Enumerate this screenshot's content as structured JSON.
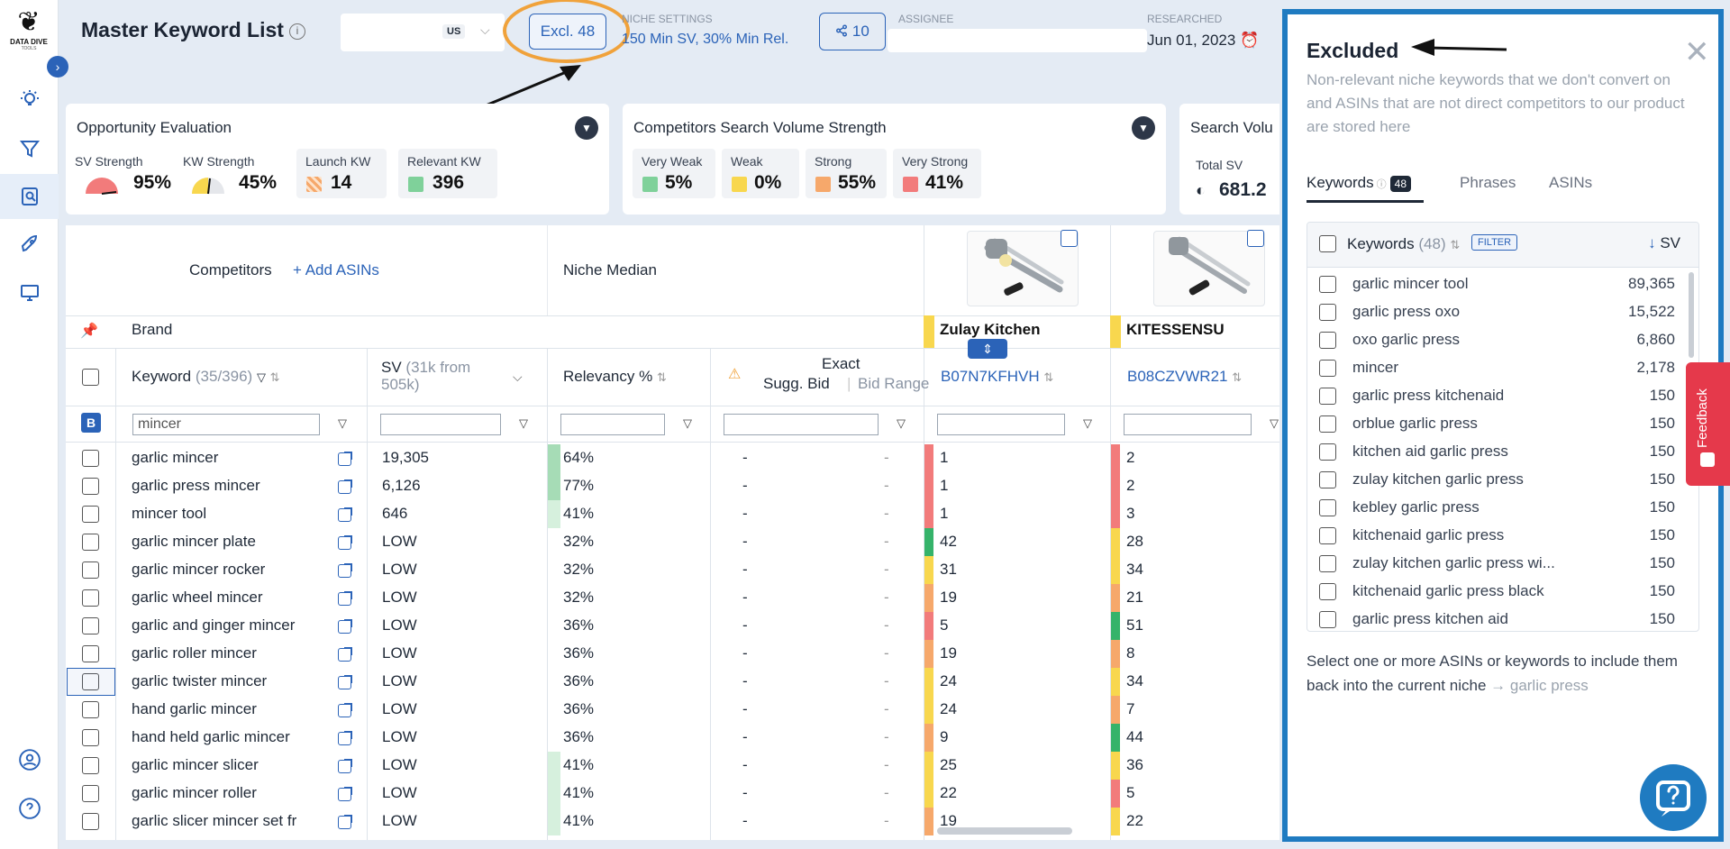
{
  "brand": {
    "name": "DATA DIVE",
    "sub": "TOOLS"
  },
  "header": {
    "title": "Master Keyword List",
    "market": "US",
    "excluded_button": "Excl. 48",
    "niche_settings_label": "NICHE SETTINGS",
    "niche_settings_value": "150 Min SV, 30% Min Rel.",
    "share_count": "10",
    "assignee_label": "ASSIGNEE",
    "researched_label": "RESEARCHED",
    "researched_date": "Jun 01, 2023"
  },
  "cards": {
    "opportunity": {
      "title": "Opportunity Evaluation",
      "sv_strength_label": "SV Strength",
      "sv_strength_value": "95%",
      "kw_strength_label": "KW Strength",
      "kw_strength_value": "45%",
      "launch_kw_label": "Launch KW",
      "launch_kw_value": "14",
      "relevant_kw_label": "Relevant KW",
      "relevant_kw_value": "396"
    },
    "competitors": {
      "title": "Competitors Search Volume Strength",
      "very_weak_label": "Very Weak",
      "very_weak_value": "5%",
      "weak_label": "Weak",
      "weak_value": "0%",
      "strong_label": "Strong",
      "strong_value": "55%",
      "very_strong_label": "Very Strong",
      "very_strong_value": "41%"
    },
    "search_volume": {
      "title": "Search Volu",
      "total_sv_label": "Total SV",
      "total_sv_value": "681.2"
    }
  },
  "colors": {
    "very_weak": "#7fd19a",
    "weak": "#f8d74e",
    "strong": "#f6a86b",
    "very_strong": "#f27b7b",
    "accent": "#2b63b8"
  },
  "table": {
    "competitors_label": "Competitors",
    "add_asins": "+ Add ASINs",
    "niche_median": "Niche Median",
    "brand_label": "Brand",
    "brand1": "Zulay Kitchen",
    "brand2": "KITESSENSU",
    "col_keyword": "Keyword",
    "col_keyword_count": "(35/396)",
    "col_sv": "SV",
    "col_sv_sub": "(31k from 505k)",
    "col_relevancy": "Relevancy %",
    "col_exact": "Exact",
    "col_sugg_bid": "Sugg. Bid",
    "col_bid_range": "Bid Range",
    "asin1": "B07N7KFHVH",
    "asin2": "B08CZVWR21",
    "filter_keyword_value": "mincer",
    "b_badge": "B",
    "rows": [
      {
        "kw": "garlic mincer",
        "sv": "19,305",
        "rel": "64%",
        "rel_color": "#a6dcb6",
        "r1": "1",
        "c1": "#f27b7b",
        "r2": "2",
        "c2": "#f27b7b"
      },
      {
        "kw": "garlic press mincer",
        "sv": "6,126",
        "rel": "77%",
        "rel_color": "#a6dcb6",
        "r1": "1",
        "c1": "#f27b7b",
        "r2": "2",
        "c2": "#f27b7b"
      },
      {
        "kw": "mincer tool",
        "sv": "646",
        "rel": "41%",
        "rel_color": "#d6f0dd",
        "r1": "1",
        "c1": "#f27b7b",
        "r2": "3",
        "c2": "#f27b7b"
      },
      {
        "kw": "garlic mincer plate",
        "sv": "LOW",
        "rel": "32%",
        "rel_color": "",
        "r1": "42",
        "c1": "#35b36a",
        "r2": "28",
        "c2": "#f8d74e"
      },
      {
        "kw": "garlic mincer rocker",
        "sv": "LOW",
        "rel": "32%",
        "rel_color": "",
        "r1": "31",
        "c1": "#f8d74e",
        "r2": "34",
        "c2": "#f8d74e"
      },
      {
        "kw": "garlic wheel mincer",
        "sv": "LOW",
        "rel": "32%",
        "rel_color": "",
        "r1": "19",
        "c1": "#f6a86b",
        "r2": "21",
        "c2": "#f6a86b"
      },
      {
        "kw": "garlic and ginger mincer",
        "sv": "LOW",
        "rel": "36%",
        "rel_color": "",
        "r1": "5",
        "c1": "#f27b7b",
        "r2": "51",
        "c2": "#35b36a"
      },
      {
        "kw": "garlic roller mincer",
        "sv": "LOW",
        "rel": "36%",
        "rel_color": "",
        "r1": "19",
        "c1": "#f6a86b",
        "r2": "8",
        "c2": "#f6a86b"
      },
      {
        "kw": "garlic twister mincer",
        "sv": "LOW",
        "rel": "36%",
        "rel_color": "",
        "r1": "24",
        "c1": "#f8d74e",
        "r2": "34",
        "c2": "#f8d74e"
      },
      {
        "kw": "hand garlic mincer",
        "sv": "LOW",
        "rel": "36%",
        "rel_color": "",
        "r1": "24",
        "c1": "#f8d74e",
        "r2": "7",
        "c2": "#f6a86b"
      },
      {
        "kw": "hand held garlic mincer",
        "sv": "LOW",
        "rel": "36%",
        "rel_color": "",
        "r1": "9",
        "c1": "#f6a86b",
        "r2": "44",
        "c2": "#35b36a"
      },
      {
        "kw": "garlic mincer slicer",
        "sv": "LOW",
        "rel": "41%",
        "rel_color": "#d6f0dd",
        "r1": "25",
        "c1": "#f8d74e",
        "r2": "36",
        "c2": "#f8d74e"
      },
      {
        "kw": "garlic mincer roller",
        "sv": "LOW",
        "rel": "41%",
        "rel_color": "#d6f0dd",
        "r1": "22",
        "c1": "#f8d74e",
        "r2": "5",
        "c2": "#f27b7b"
      },
      {
        "kw": "garlic slicer mincer set fr",
        "sv": "LOW",
        "rel": "41%",
        "rel_color": "#d6f0dd",
        "r1": "19",
        "c1": "#f6a86b",
        "r2": "22",
        "c2": "#f8d74e"
      }
    ],
    "dash": "-"
  },
  "panel": {
    "title": "Excluded",
    "description": "Non-relevant niche keywords that we don't convert on and ASINs that are not direct competitors to our product are stored here",
    "tab_keywords": "Keywords",
    "tab_keywords_count": "48",
    "tab_phrases": "Phrases",
    "tab_asins": "ASINs",
    "list_header": "Keywords",
    "list_count": "(48)",
    "filter_tag": "FILTER",
    "sort_col": "SV",
    "keywords": [
      {
        "k": "garlic mincer tool",
        "v": "89,365"
      },
      {
        "k": "garlic press oxo",
        "v": "15,522"
      },
      {
        "k": "oxo garlic press",
        "v": "6,860"
      },
      {
        "k": "mincer",
        "v": "2,178"
      },
      {
        "k": "garlic press kitchenaid",
        "v": "150"
      },
      {
        "k": "orblue garlic press",
        "v": "150"
      },
      {
        "k": "kitchen aid garlic press",
        "v": "150"
      },
      {
        "k": "zulay kitchen garlic press",
        "v": "150"
      },
      {
        "k": "kebley garlic press",
        "v": "150"
      },
      {
        "k": "kitchenaid garlic press",
        "v": "150"
      },
      {
        "k": "zulay kitchen garlic press wi...",
        "v": "150"
      },
      {
        "k": "kitchenaid garlic press black",
        "v": "150"
      },
      {
        "k": "garlic press kitchen aid",
        "v": "150"
      }
    ],
    "hint": "Select one or more ASINs or keywords to include them back into the current niche",
    "hint_niche": "→ garlic press"
  },
  "feedback": "Feedback"
}
